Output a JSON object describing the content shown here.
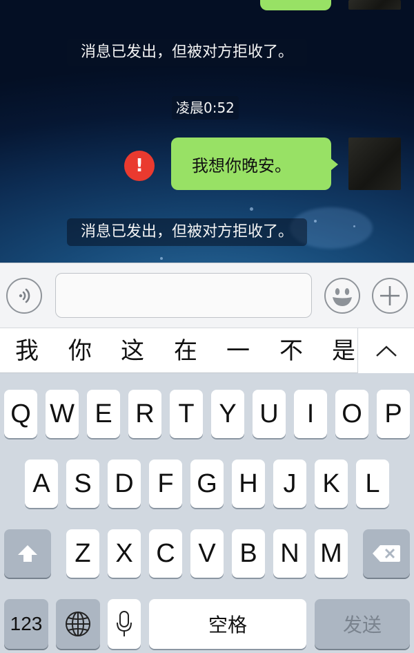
{
  "chat": {
    "notice_top": "消息已发出，但被对方拒收了。",
    "timestamp": "凌晨0:52",
    "message": "我想你晚安。",
    "error_symbol": "!",
    "notice_bottom": "消息已发出，但被对方拒收了。",
    "bubble_color": "#98e165",
    "error_color": "#ea3a2f"
  },
  "input_bar": {
    "voice_icon": "voice-wave-icon",
    "emoji_icon": "smile-emoji-icon",
    "plus_icon": "plus-icon",
    "text_value": ""
  },
  "candidates": {
    "items": [
      "我",
      "你",
      "这",
      "在",
      "一",
      "不",
      "是"
    ],
    "expand_icon": "chevron-up-icon"
  },
  "keyboard": {
    "row1": [
      "Q",
      "W",
      "E",
      "R",
      "T",
      "Y",
      "U",
      "I",
      "O",
      "P"
    ],
    "row2": [
      "A",
      "S",
      "D",
      "F",
      "G",
      "H",
      "J",
      "K",
      "L"
    ],
    "row3": [
      "Z",
      "X",
      "C",
      "V",
      "B",
      "N",
      "M"
    ],
    "numbers_label": "123",
    "space_label": "空格",
    "send_label": "发送",
    "shift_icon": "shift-arrow-icon",
    "delete_icon": "backspace-icon",
    "globe_icon": "globe-icon",
    "mic_icon": "microphone-icon"
  }
}
